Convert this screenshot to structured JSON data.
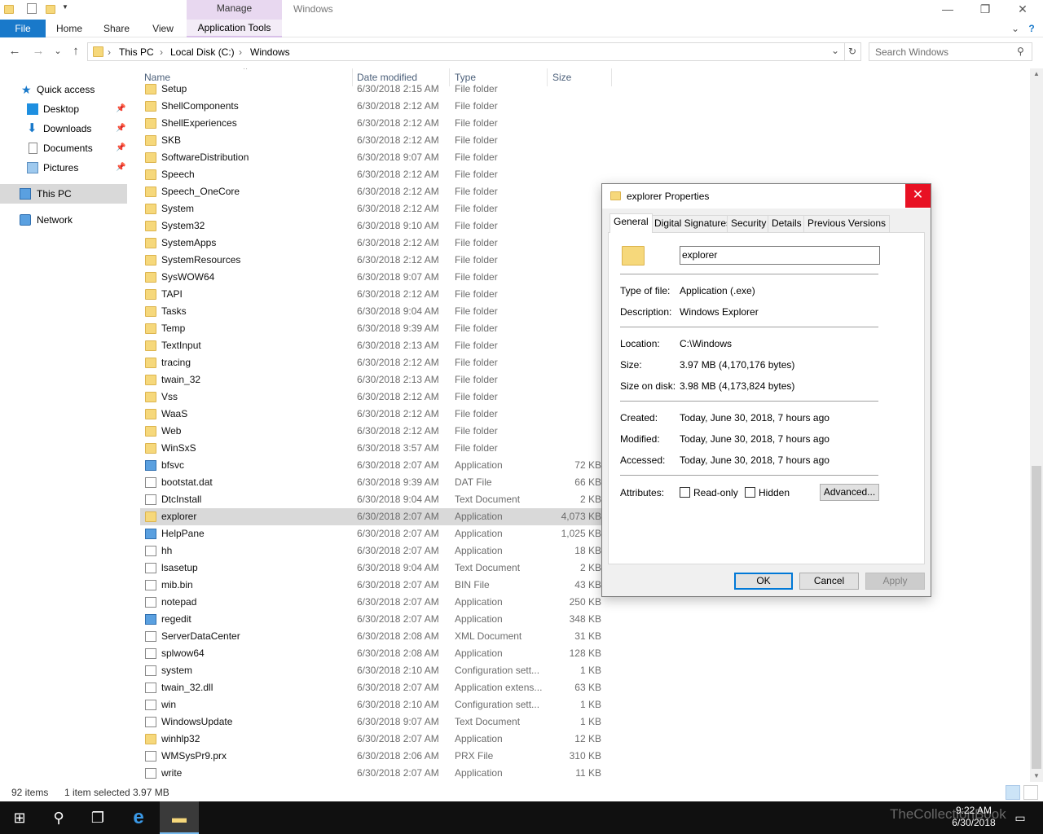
{
  "titlebar": {
    "manage_label": "Manage",
    "window_title": "Windows",
    "minimize": "—",
    "restore": "❐",
    "close": "✕"
  },
  "ribbon": {
    "file": "File",
    "home": "Home",
    "share": "Share",
    "view": "View",
    "app_tools": "Application Tools",
    "expand_chevron": "⌄",
    "help": "?"
  },
  "address": {
    "back": "←",
    "forward": "→",
    "recent": "⌄",
    "up": "↑",
    "crumbs": [
      "This PC",
      "Local Disk (C:)",
      "Windows"
    ],
    "separator": "›",
    "dropdown": "⌄",
    "refresh": "↻",
    "search_placeholder": "Search Windows"
  },
  "nav": {
    "items": [
      {
        "label": "Quick access",
        "icon": "star-icon"
      },
      {
        "label": "Desktop",
        "icon": "desktop-icon",
        "pinned": true
      },
      {
        "label": "Downloads",
        "icon": "download-icon",
        "pinned": true
      },
      {
        "label": "Documents",
        "icon": "documents-icon",
        "pinned": true
      },
      {
        "label": "Pictures",
        "icon": "pictures-icon",
        "pinned": true
      },
      {
        "label": "This PC",
        "icon": "computer-icon",
        "selected": true
      },
      {
        "label": "Network",
        "icon": "network-icon"
      }
    ]
  },
  "columns": {
    "name": "Name",
    "date": "Date modified",
    "type": "Type",
    "size": "Size"
  },
  "files": [
    {
      "name": "Setup",
      "date": "6/30/2018 2:15 AM",
      "type": "File folder",
      "size": "",
      "kind": "folder"
    },
    {
      "name": "ShellComponents",
      "date": "6/30/2018 2:12 AM",
      "type": "File folder",
      "size": "",
      "kind": "folder"
    },
    {
      "name": "ShellExperiences",
      "date": "6/30/2018 2:12 AM",
      "type": "File folder",
      "size": "",
      "kind": "folder"
    },
    {
      "name": "SKB",
      "date": "6/30/2018 2:12 AM",
      "type": "File folder",
      "size": "",
      "kind": "folder"
    },
    {
      "name": "SoftwareDistribution",
      "date": "6/30/2018 9:07 AM",
      "type": "File folder",
      "size": "",
      "kind": "folder"
    },
    {
      "name": "Speech",
      "date": "6/30/2018 2:12 AM",
      "type": "File folder",
      "size": "",
      "kind": "folder"
    },
    {
      "name": "Speech_OneCore",
      "date": "6/30/2018 2:12 AM",
      "type": "File folder",
      "size": "",
      "kind": "folder"
    },
    {
      "name": "System",
      "date": "6/30/2018 2:12 AM",
      "type": "File folder",
      "size": "",
      "kind": "folder"
    },
    {
      "name": "System32",
      "date": "6/30/2018 9:10 AM",
      "type": "File folder",
      "size": "",
      "kind": "folder"
    },
    {
      "name": "SystemApps",
      "date": "6/30/2018 2:12 AM",
      "type": "File folder",
      "size": "",
      "kind": "folder"
    },
    {
      "name": "SystemResources",
      "date": "6/30/2018 2:12 AM",
      "type": "File folder",
      "size": "",
      "kind": "folder"
    },
    {
      "name": "SysWOW64",
      "date": "6/30/2018 9:07 AM",
      "type": "File folder",
      "size": "",
      "kind": "folder"
    },
    {
      "name": "TAPI",
      "date": "6/30/2018 2:12 AM",
      "type": "File folder",
      "size": "",
      "kind": "folder"
    },
    {
      "name": "Tasks",
      "date": "6/30/2018 9:04 AM",
      "type": "File folder",
      "size": "",
      "kind": "folder"
    },
    {
      "name": "Temp",
      "date": "6/30/2018 9:39 AM",
      "type": "File folder",
      "size": "",
      "kind": "folder"
    },
    {
      "name": "TextInput",
      "date": "6/30/2018 2:13 AM",
      "type": "File folder",
      "size": "",
      "kind": "folder"
    },
    {
      "name": "tracing",
      "date": "6/30/2018 2:12 AM",
      "type": "File folder",
      "size": "",
      "kind": "folder"
    },
    {
      "name": "twain_32",
      "date": "6/30/2018 2:13 AM",
      "type": "File folder",
      "size": "",
      "kind": "folder"
    },
    {
      "name": "Vss",
      "date": "6/30/2018 2:12 AM",
      "type": "File folder",
      "size": "",
      "kind": "folder"
    },
    {
      "name": "WaaS",
      "date": "6/30/2018 2:12 AM",
      "type": "File folder",
      "size": "",
      "kind": "folder"
    },
    {
      "name": "Web",
      "date": "6/30/2018 2:12 AM",
      "type": "File folder",
      "size": "",
      "kind": "folder"
    },
    {
      "name": "WinSxS",
      "date": "6/30/2018 3:57 AM",
      "type": "File folder",
      "size": "",
      "kind": "folder"
    },
    {
      "name": "bfsvc",
      "date": "6/30/2018 2:07 AM",
      "type": "Application",
      "size": "72 KB",
      "kind": "app"
    },
    {
      "name": "bootstat.dat",
      "date": "6/30/2018 9:39 AM",
      "type": "DAT File",
      "size": "66 KB",
      "kind": "doc"
    },
    {
      "name": "DtcInstall",
      "date": "6/30/2018 9:04 AM",
      "type": "Text Document",
      "size": "2 KB",
      "kind": "doc"
    },
    {
      "name": "explorer",
      "date": "6/30/2018 2:07 AM",
      "type": "Application",
      "size": "4,073 KB",
      "kind": "folder",
      "selected": true
    },
    {
      "name": "HelpPane",
      "date": "6/30/2018 2:07 AM",
      "type": "Application",
      "size": "1,025 KB",
      "kind": "app"
    },
    {
      "name": "hh",
      "date": "6/30/2018 2:07 AM",
      "type": "Application",
      "size": "18 KB",
      "kind": "doc"
    },
    {
      "name": "lsasetup",
      "date": "6/30/2018 9:04 AM",
      "type": "Text Document",
      "size": "2 KB",
      "kind": "doc"
    },
    {
      "name": "mib.bin",
      "date": "6/30/2018 2:07 AM",
      "type": "BIN File",
      "size": "43 KB",
      "kind": "doc"
    },
    {
      "name": "notepad",
      "date": "6/30/2018 2:07 AM",
      "type": "Application",
      "size": "250 KB",
      "kind": "doc"
    },
    {
      "name": "regedit",
      "date": "6/30/2018 2:07 AM",
      "type": "Application",
      "size": "348 KB",
      "kind": "app"
    },
    {
      "name": "ServerDataCenter",
      "date": "6/30/2018 2:08 AM",
      "type": "XML Document",
      "size": "31 KB",
      "kind": "doc"
    },
    {
      "name": "splwow64",
      "date": "6/30/2018 2:08 AM",
      "type": "Application",
      "size": "128 KB",
      "kind": "doc"
    },
    {
      "name": "system",
      "date": "6/30/2018 2:10 AM",
      "type": "Configuration sett...",
      "size": "1 KB",
      "kind": "doc"
    },
    {
      "name": "twain_32.dll",
      "date": "6/30/2018 2:07 AM",
      "type": "Application extens...",
      "size": "63 KB",
      "kind": "doc"
    },
    {
      "name": "win",
      "date": "6/30/2018 2:10 AM",
      "type": "Configuration sett...",
      "size": "1 KB",
      "kind": "doc"
    },
    {
      "name": "WindowsUpdate",
      "date": "6/30/2018 9:07 AM",
      "type": "Text Document",
      "size": "1 KB",
      "kind": "doc"
    },
    {
      "name": "winhlp32",
      "date": "6/30/2018 2:07 AM",
      "type": "Application",
      "size": "12 KB",
      "kind": "folder"
    },
    {
      "name": "WMSysPr9.prx",
      "date": "6/30/2018 2:06 AM",
      "type": "PRX File",
      "size": "310 KB",
      "kind": "doc"
    },
    {
      "name": "write",
      "date": "6/30/2018 2:07 AM",
      "type": "Application",
      "size": "11 KB",
      "kind": "doc"
    }
  ],
  "status": {
    "count": "92 items",
    "selection": "1 item selected  3.97 MB"
  },
  "dialog": {
    "title": "explorer Properties",
    "close": "✕",
    "tabs": [
      "General",
      "Digital Signatures",
      "Security",
      "Details",
      "Previous Versions"
    ],
    "name_value": "explorer",
    "type_label": "Type of file:",
    "type_value": "Application (.exe)",
    "desc_label": "Description:",
    "desc_value": "Windows Explorer",
    "loc_label": "Location:",
    "loc_value": "C:\\Windows",
    "size_label": "Size:",
    "size_value": "3.97 MB (4,170,176 bytes)",
    "disk_label": "Size on disk:",
    "disk_value": "3.98 MB (4,173,824 bytes)",
    "created_label": "Created:",
    "created_value": "Today, June 30, 2018, 7 hours ago",
    "modified_label": "Modified:",
    "modified_value": "Today, June 30, 2018, 7 hours ago",
    "accessed_label": "Accessed:",
    "accessed_value": "Today, June 30, 2018, 7 hours ago",
    "attr_label": "Attributes:",
    "readonly": "Read-only",
    "hidden": "Hidden",
    "advanced": "Advanced...",
    "ok": "OK",
    "cancel": "Cancel",
    "apply": "Apply"
  },
  "taskbar": {
    "start": "⊞",
    "search": "⚲",
    "taskview": "❐",
    "ie": "e",
    "explorer": "▬",
    "time": "9:22 AM",
    "date": "6/30/2018",
    "watermark": "TheCollectionBook"
  },
  "colors": {
    "accent": "#1979ca",
    "selection": "#d9d9d9",
    "close_red": "#e81123"
  }
}
